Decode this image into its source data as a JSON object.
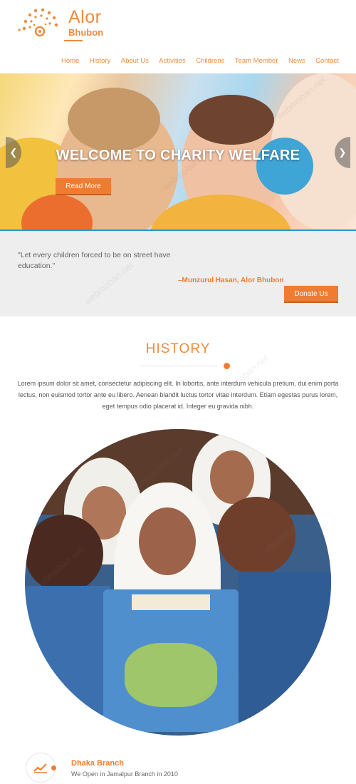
{
  "logo": {
    "title": "Alor",
    "subtitle": "Bhubon"
  },
  "nav": [
    "Home",
    "History",
    "About Us",
    "Activities",
    "Childrens",
    "Team Member",
    "News",
    "Contact"
  ],
  "hero": {
    "title": "WELCOME TO CHARITY WELFARE",
    "button": "Read More"
  },
  "quote": {
    "text": "\"Let every children forced to be on street have education.\"",
    "author": "–Munzurul Hasan, Alor Bhubon",
    "button": "Donate Us"
  },
  "history": {
    "title": "HISTORY",
    "text": "Lorem ipsum dolor sit amet, consectetur adipiscing elit. In lobortis, ante interdum vehicula pretium, dui enim porta lectus, non euismod tortor ante eu libero. Aenean blandit luctus tortor vitae interdum. Etiam egestas purus lorem, eget tempus odio placerat id. Integer eu gravida nibh."
  },
  "branch": {
    "title": "Dhaka Branch",
    "subtitle": "We Open in Jamalpur Branch in 2010"
  },
  "watermark": "webmoban.net",
  "colors": {
    "accent": "#f07c32",
    "hero_line": "#1f9bd6",
    "quote_bg": "#eeeeee"
  },
  "icons": {
    "arrow_left": "chevron-left-icon",
    "arrow_right": "chevron-right-icon",
    "branch": "chart-line-icon"
  }
}
